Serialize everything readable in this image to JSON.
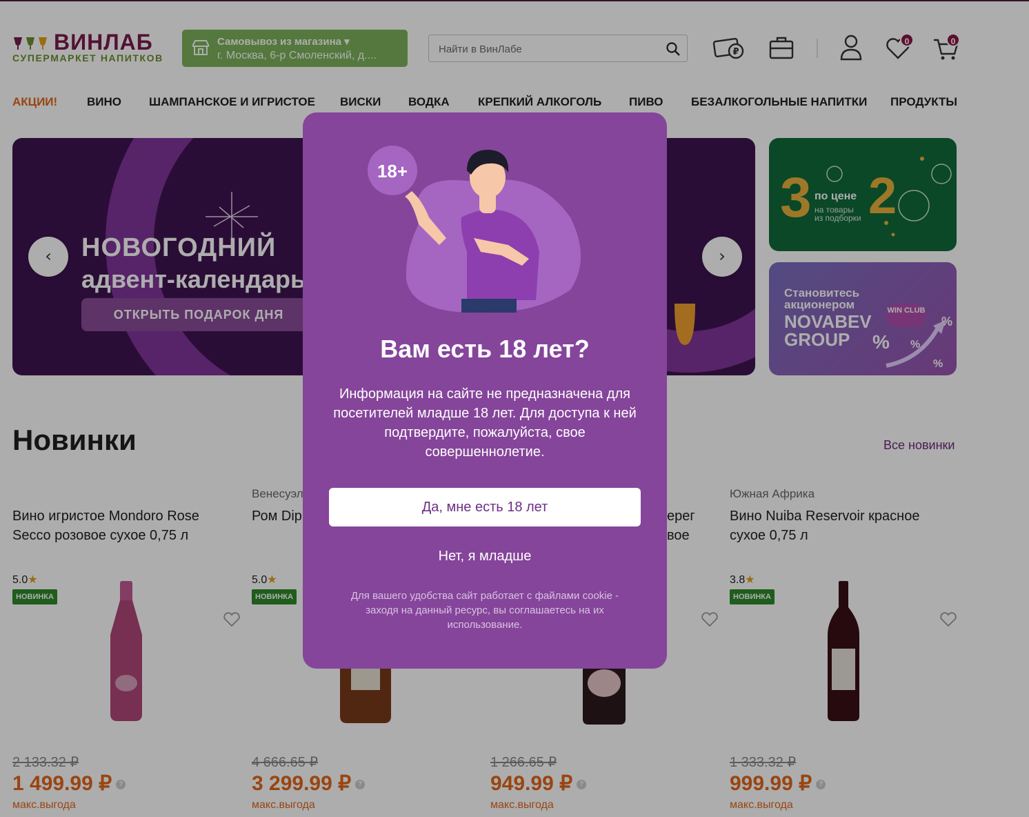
{
  "header": {
    "logo_name": "ВИНЛАБ",
    "logo_sub": "СУПЕРМАРКЕТ НАПИТКОВ",
    "pickup_title": "Самовывоз из магазина ▾",
    "pickup_address": "г. Москва, 6-р Смоленский, д....",
    "search_placeholder": "Найти в ВинЛабе",
    "favorites_count": "0",
    "cart_count": "0"
  },
  "nav": {
    "items": [
      "АКЦИИ!",
      "ВИНО",
      "ШАМПАНСКОЕ И ИГРИСТОЕ",
      "ВИСКИ",
      "ВОДКА",
      "КРЕПКИЙ АЛКОГОЛЬ",
      "ПИВО",
      "БЕЗАЛКОГОЛЬНЫЕ НАПИТКИ",
      "ПРОДУКТЫ"
    ]
  },
  "banner": {
    "title1": "НОВОГОДНИЙ",
    "title2": "адвент-календарь",
    "button": "ОТКРЫТЬ ПОДАРОК ДНЯ",
    "prev_arrow": "‹",
    "next_arrow": "›"
  },
  "side_banner_1": {
    "big3": "3",
    "by_price": "по цене",
    "big2": "2",
    "note": "на товары\nиз подборки"
  },
  "side_banner_2": {
    "line1": "Становитесь",
    "line2": "акционером",
    "line3": "NOVABEV",
    "line4": "GROUP",
    "club": "WIN CLUB"
  },
  "section": {
    "title": "Новинки",
    "all_link": "Все новинки"
  },
  "products": [
    {
      "country": "",
      "name": "Вино игристое Mondoro Rose Secco розовое сухое 0,75 л",
      "rating": "5.0",
      "tag": "НОВИНКА",
      "old_price": "2 133.32 ₽",
      "new_price": "1 499.99 ₽",
      "note": "макс.выгода",
      "bottle_color": "#b0467a"
    },
    {
      "country": "Венесуэл",
      "name": "Ром Dip",
      "rating": "5.0",
      "tag": "НОВИНКА",
      "old_price": "4 666.65 ₽",
      "new_price": "3 299.99 ₽",
      "note": "макс.выгода",
      "bottle_color": "#7a3a1a"
    },
    {
      "country": "",
      "name": "ерег\nвое",
      "rating": "",
      "tag": "",
      "old_price": "1 266.65 ₽",
      "new_price": "949.99 ₽",
      "note": "макс.выгода",
      "bottle_color": "#2b1a1e"
    },
    {
      "country": "Южная Африка",
      "name": "Вино Nuiba Reservoir красное сухое 0,75 л",
      "rating": "3.8",
      "tag": "НОВИНКА",
      "old_price": "1 333.32 ₽",
      "new_price": "999.99 ₽",
      "note": "макс.выгода",
      "bottle_color": "#3a1016"
    }
  ],
  "modal": {
    "badge": "18+",
    "title": "Вам есть 18 лет?",
    "message": "Информация на сайте не предназначена для посетителей младше 18 лет. Для доступа к ней подтвердите, пожалуйста, свое совершеннолетие.",
    "yes_button": "Да, мне есть 18 лет",
    "no_button": "Нет, я младше",
    "cookie_note": "Для вашего удобства сайт работает с файлами cookie - заходя на данный ресурс, вы соглашаетесь на их использование."
  },
  "colors": {
    "brand": "#7a1b4f",
    "accent_orange": "#e2661b",
    "modal_bg": "#85459a",
    "pickup_green": "#7db15a"
  }
}
